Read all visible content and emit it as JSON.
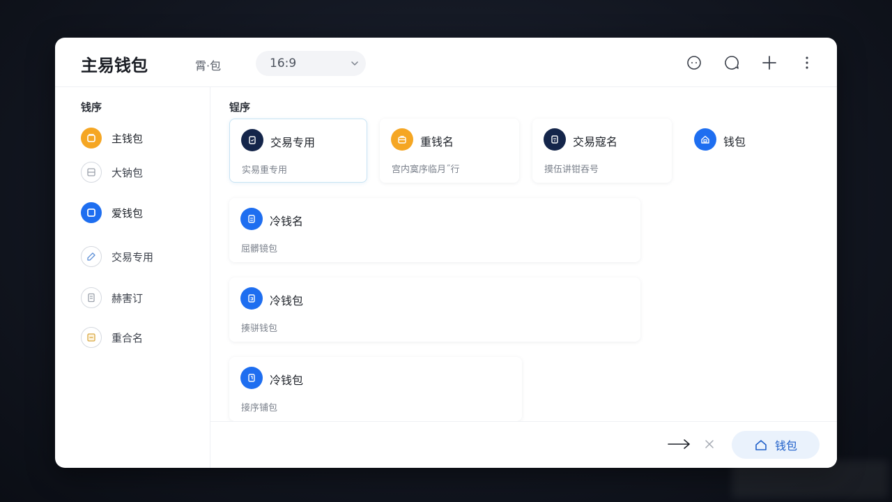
{
  "app": {
    "title": "主易钱包",
    "top_label": "霄·包"
  },
  "ratio_select": {
    "value": "16:9"
  },
  "top_icons": [
    "smile-icon",
    "chat-icon",
    "plus-icon",
    "more-icon"
  ],
  "sidebar": {
    "heading": "钱序",
    "items": [
      {
        "label": "主钱包",
        "icon": "wallet-icon",
        "style": "orange"
      },
      {
        "label": "大钠包",
        "icon": "calendar-icon",
        "style": "outline"
      },
      {
        "label": "爱钱包",
        "icon": "square-icon",
        "style": "blue"
      },
      {
        "label": "交易专用",
        "icon": "edit-icon",
        "style": "outline"
      },
      {
        "label": "赫害订",
        "icon": "document-icon",
        "style": "outline"
      },
      {
        "label": "重合名",
        "icon": "note-icon",
        "style": "outline"
      }
    ]
  },
  "main": {
    "heading": "锃序",
    "cards": [
      {
        "title": "交易专用",
        "subtitle": "实易重专用",
        "icon_color": "navy",
        "selected": true
      },
      {
        "title": "重钱名",
        "subtitle": "宫内寞序临月˝行",
        "icon_color": "orange",
        "selected": false
      },
      {
        "title": "交易寇名",
        "subtitle": "摸伍讲钳吞号",
        "icon_color": "navy",
        "selected": false
      },
      {
        "title": "钱包",
        "subtitle": "",
        "icon_color": "blue",
        "selected": false
      },
      {
        "title": "冷钱名",
        "subtitle": "屈髒镜包",
        "icon_color": "blue",
        "selected": false
      },
      {
        "title": "冷钱包",
        "subtitle": "揍骈钱包",
        "icon_color": "blue",
        "selected": false
      },
      {
        "title": "冷钱包",
        "subtitle": "接序铺包",
        "icon_color": "blue",
        "selected": false
      }
    ]
  },
  "footer": {
    "wallet_button": "钱包"
  },
  "colors": {
    "accent_blue": "#1e6ef0",
    "orange": "#f5a623",
    "navy": "#14254a"
  }
}
